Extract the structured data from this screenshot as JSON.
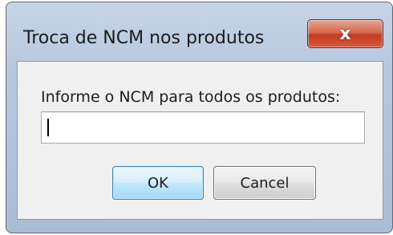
{
  "dialog": {
    "title": "Troca de NCM nos produtos",
    "close_label": "x",
    "prompt": "Informe o NCM para todos os produtos:",
    "input_value": "",
    "ok_label": "OK",
    "cancel_label": "Cancel"
  },
  "colors": {
    "titlebar": "#b6c8de",
    "close_button": "#c23a22",
    "client_background": "#f0f0f0",
    "ok_border": "#3c7fb1"
  }
}
